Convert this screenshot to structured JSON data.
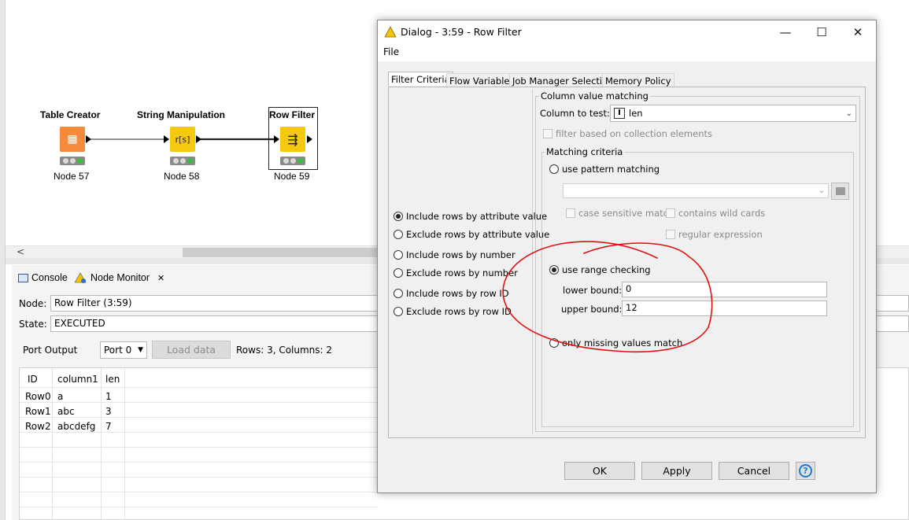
{
  "workflow": {
    "nodes": [
      {
        "title": "Table Creator",
        "label": "Node 57",
        "color": "#f58b3a",
        "icon": "table-grid-icon",
        "glyph": "▦"
      },
      {
        "title": "String Manipulation",
        "label": "Node 58",
        "color": "#f6c90e",
        "icon": "string-manipulation-icon",
        "glyph": "r[s]"
      },
      {
        "title": "Row Filter",
        "label": "Node 59",
        "color": "#f6c90e",
        "icon": "row-filter-icon",
        "glyph": "⇶"
      }
    ],
    "scroll_left_glyph": "<"
  },
  "bottom_panel": {
    "tabs": [
      {
        "label": "Console",
        "icon": "console-icon"
      },
      {
        "label": "Node Monitor",
        "icon": "warning-icon",
        "close": "✕"
      }
    ],
    "node_label": "Node:",
    "node_value": "Row Filter  (3:59)",
    "state_label": "State:",
    "state_value": "EXECUTED",
    "port_output_label": "Port Output",
    "port_select": "Port 0",
    "load_data_label": "Load data",
    "rows_info": "Rows: 3, Columns: 2",
    "table": {
      "columns": [
        "ID",
        "column1",
        "len"
      ],
      "rows": [
        [
          "Row0",
          "a",
          "1"
        ],
        [
          "Row1",
          "abc",
          "3"
        ],
        [
          "Row2",
          "abcdefg",
          "7"
        ]
      ]
    }
  },
  "dialog": {
    "title": "Dialog - 3:59 - Row Filter",
    "menu_file": "File",
    "window_buttons": {
      "minimize": "—",
      "maximize": "☐",
      "close": "✕"
    },
    "tabs": [
      "Filter Criteria",
      "Flow Variables",
      "Job Manager Selection",
      "Memory Policy"
    ],
    "selected_tab": "Filter Criteria",
    "include_exclude_options": [
      {
        "label": "Include rows by attribute value",
        "selected": true
      },
      {
        "label": "Exclude rows by attribute value",
        "selected": false
      },
      {
        "label": "Include rows by number",
        "selected": false
      },
      {
        "label": "Exclude rows by number",
        "selected": false
      },
      {
        "label": "Include rows by row ID",
        "selected": false
      },
      {
        "label": "Exclude rows by row ID",
        "selected": false
      }
    ],
    "column_value_matching": {
      "group_title": "Column value matching",
      "column_to_test_label": "Column to test:",
      "column_to_test_value": "len",
      "column_type_badge": "I",
      "filter_collection_label": "filter based on collection elements"
    },
    "matching_criteria": {
      "group_title": "Matching criteria",
      "use_pattern_matching": "use pattern matching",
      "case_sensitive_label": "case sensitive match",
      "contains_wild_cards_label": "contains wild cards",
      "regular_expression_label": "regular expression",
      "use_range_checking": "use range checking",
      "lower_bound_label": "lower bound:",
      "lower_bound_value": "0",
      "upper_bound_label": "upper bound:",
      "upper_bound_value": "12",
      "only_missing_label": "only missing values match",
      "selected": "use range checking"
    },
    "buttons": {
      "ok": "OK",
      "apply": "Apply",
      "cancel": "Cancel",
      "help": "?"
    }
  },
  "colors": {
    "warning_yellow": "#f5c400",
    "annotation_red": "#e01010",
    "help_blue": "#1e7bd6",
    "traffic_green": "#3dbd3d"
  }
}
